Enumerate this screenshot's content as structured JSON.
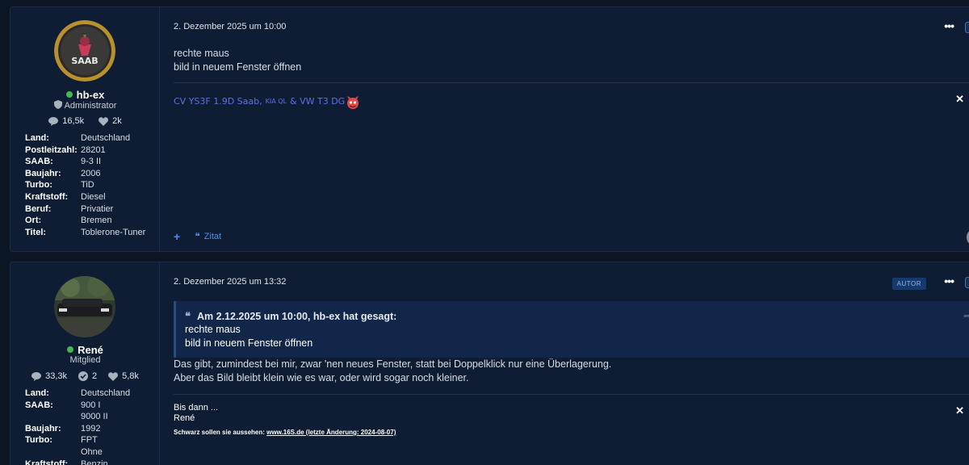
{
  "posts": [
    {
      "author": {
        "name": "hb-ex",
        "role": "Administrator",
        "messages": "16,5k",
        "likes": "2k",
        "avatar_label": "SAAB",
        "fields": [
          {
            "k": "Land:",
            "v": "Deutschland"
          },
          {
            "k": "Postleitzahl:",
            "v": "28201"
          },
          {
            "k": "SAAB:",
            "v": "9-3 II"
          },
          {
            "k": "Baujahr:",
            "v": "2006"
          },
          {
            "k": "Turbo:",
            "v": "TiD"
          },
          {
            "k": "Kraftstoff:",
            "v": "Diesel"
          },
          {
            "k": "Beruf:",
            "v": "Privatier"
          },
          {
            "k": "Ort:",
            "v": "Bremen"
          },
          {
            "k": "Titel:",
            "v": "Toblerone-Tuner"
          }
        ]
      },
      "date": "2. Dezember 2025 um 10:00",
      "body": [
        "rechte maus",
        "bild in neuem Fenster öffnen"
      ],
      "signature": {
        "part1": "CV YS3F 1.9D Saab,",
        "part2": "KIA QL",
        "part3": "& VW T3 DG"
      },
      "actions": {
        "plus": "+",
        "quote_label": "Zitat"
      }
    },
    {
      "author": {
        "name": "René",
        "role": "Mitglied",
        "messages": "33,3k",
        "solutions": "2",
        "likes": "5,8k",
        "fields": [
          {
            "k": "Land:",
            "v": "Deutschland"
          },
          {
            "k": "SAAB:",
            "v": "900 I"
          },
          {
            "k": "",
            "v": "9000 II"
          },
          {
            "k": "Baujahr:",
            "v": "1992"
          },
          {
            "k": "Turbo:",
            "v": "FPT"
          },
          {
            "k": "",
            "v": "Ohne"
          },
          {
            "k": "Kraftstoff:",
            "v": "Benzin"
          }
        ]
      },
      "date": "2. Dezember 2025 um 13:32",
      "badge": "AUTOR",
      "quote": {
        "header": "Am 2.12.2025 um 10:00, hb-ex hat gesagt:",
        "lines": [
          "rechte maus",
          "bild in neuem Fenster öffnen"
        ]
      },
      "body": [
        "Das gibt, zumindest bei mir, zwar 'nen neues Fenster, statt bei Doppelklick nur eine Überlagerung.",
        "Aber das Bild bleibt klein wie es war, oder wird sogar noch kleiner."
      ],
      "signature": {
        "lines": [
          "Bis dann ...",
          "René"
        ],
        "small_prefix": "Schwarz sollen sie aussehen:",
        "small_link": "www.16S.de (letzte Änderung: 2024-08-07)"
      }
    }
  ],
  "icons": {
    "dots": "•••",
    "close": "✕",
    "caret": "▼",
    "quote_mark": "❝",
    "share": "➦"
  },
  "colors": {
    "online": "#3fb950",
    "link": "#4d8ef0",
    "sig_link": "#5d6ff0"
  }
}
